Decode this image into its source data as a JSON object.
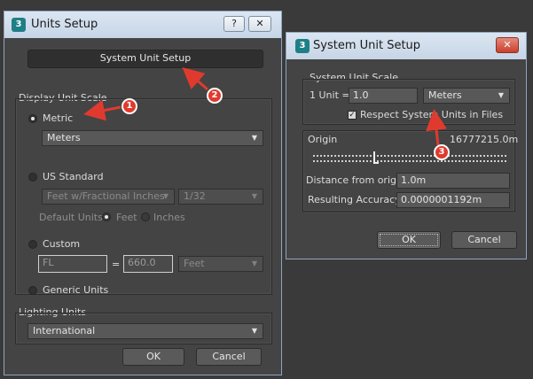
{
  "units_setup": {
    "title": "Units Setup",
    "icon_glyph": "3",
    "help_glyph": "?",
    "close_glyph": "✕",
    "system_unit_setup_button": "System Unit Setup",
    "display_unit_scale_label": "Display Unit Scale",
    "metric_label": "Metric",
    "metric_value": "Meters",
    "us_standard_label": "US Standard",
    "us_standard_value": "Feet w/Fractional Inches",
    "fraction_value": "1/32",
    "default_units_label": "Default Units:",
    "feet_label": "Feet",
    "inches_label": "Inches",
    "custom_label": "Custom",
    "custom_name_value": "FL",
    "equals": "=",
    "custom_amount_value": "660.0",
    "custom_unit_value": "Feet",
    "generic_units_label": "Generic Units",
    "lighting_units_label": "Lighting Units",
    "lighting_value": "International",
    "ok_label": "OK",
    "cancel_label": "Cancel"
  },
  "system_unit_setup": {
    "title": "System Unit Setup",
    "icon_glyph": "3",
    "close_glyph": "✕",
    "scale_label": "System Unit Scale",
    "one_unit_label": "1 Unit =",
    "unit_amount_value": "1.0",
    "unit_value": "Meters",
    "respect_label": "Respect System Units in Files",
    "respect_checked": "✓",
    "origin_label": "Origin",
    "origin_value": "16777215.0m",
    "distance_label": "Distance from origin:",
    "distance_value": "1.0m",
    "accuracy_label": "Resulting Accuracy:",
    "accuracy_value": "0.0000001192m",
    "ok_label": "OK",
    "cancel_label": "Cancel"
  },
  "annotations": {
    "marker1": "1",
    "marker2": "2",
    "marker3": "3",
    "color": "#e03a2e"
  },
  "colors": {
    "window_bg": "#444444",
    "titlebar": "#d4e0ee",
    "desktop": "#3a3a3a"
  }
}
